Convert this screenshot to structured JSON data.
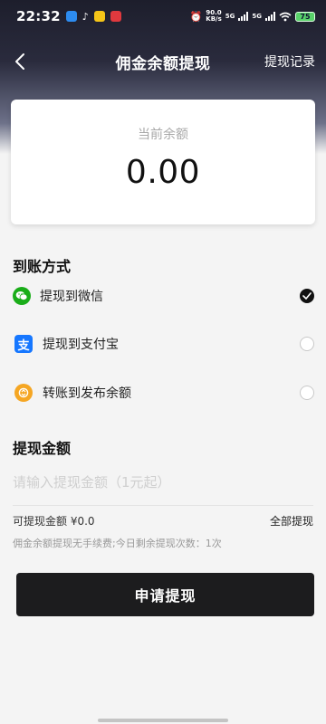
{
  "status_bar": {
    "time": "22:32",
    "net_speed_value": "90.0",
    "net_speed_unit": "KB/s",
    "sim1": "5G",
    "sim2": "5G",
    "battery": "75"
  },
  "nav": {
    "title": "佣金余额提现",
    "right_link": "提现记录",
    "back_icon": "chevron-left-icon"
  },
  "balance": {
    "label": "当前余额",
    "value": "0.00"
  },
  "methods": {
    "title": "到账方式",
    "items": [
      {
        "label": "提现到微信",
        "icon": "wechat-icon",
        "color": "#1aad19",
        "selected": true
      },
      {
        "label": "提现到支付宝",
        "icon": "alipay-icon",
        "color": "#1677ff",
        "selected": false
      },
      {
        "label": "转账到发布余额",
        "icon": "transfer-icon",
        "color": "#f5a623",
        "selected": false
      }
    ]
  },
  "amount": {
    "title": "提现金额",
    "placeholder": "请输入提现金额（1元起）",
    "available": "可提现金额 ¥0.0",
    "withdraw_all": "全部提现",
    "note": "佣金余额提现无手续费;今日剩余提现次数：1次"
  },
  "submit": {
    "label": "申请提现"
  },
  "colors": {
    "accent": "#1c1c1e",
    "header_dark": "#1d1e2c"
  }
}
